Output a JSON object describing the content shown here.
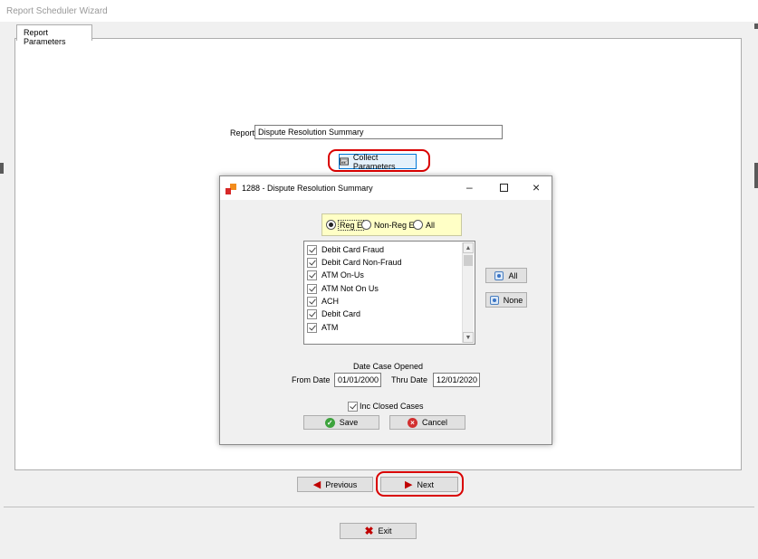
{
  "window": {
    "title": "Report Scheduler Wizard"
  },
  "tabs": [
    {
      "label": "Report Parameters"
    }
  ],
  "report": {
    "label": "Report",
    "value": "Dispute Resolution Summary"
  },
  "collect_button": {
    "label": "Collect Parameters"
  },
  "dialog": {
    "title": "1288 - Dispute Resolution Summary",
    "radios": [
      {
        "label": "Reg E",
        "selected": true
      },
      {
        "label": "Non-Reg E",
        "selected": false
      },
      {
        "label": "All",
        "selected": false
      }
    ],
    "list_items": [
      {
        "label": "Debit Card Fraud",
        "checked": true
      },
      {
        "label": "Debit Card Non-Fraud",
        "checked": true
      },
      {
        "label": "ATM On-Us",
        "checked": true
      },
      {
        "label": "ATM Not On Us",
        "checked": true
      },
      {
        "label": "ACH",
        "checked": true
      },
      {
        "label": "Debit Card",
        "checked": true
      },
      {
        "label": "ATM",
        "checked": true
      }
    ],
    "all_button": "All",
    "none_button": "None",
    "date_group_label": "Date Case Opened",
    "from_label": "From Date",
    "from_value": "01/01/2000",
    "thru_label": "Thru Date",
    "thru_value": "12/01/2020",
    "inc_closed": {
      "label": "Inc Closed Cases",
      "checked": true
    },
    "save_button": "Save",
    "cancel_button": "Cancel"
  },
  "nav": {
    "previous_label": "Previous",
    "next_label": "Next"
  },
  "exit_button": {
    "label": "Exit"
  },
  "colors": {
    "highlight_ring": "#d90000",
    "radio_group_bg": "#ffffc6",
    "arrow_red": "#c00000"
  }
}
